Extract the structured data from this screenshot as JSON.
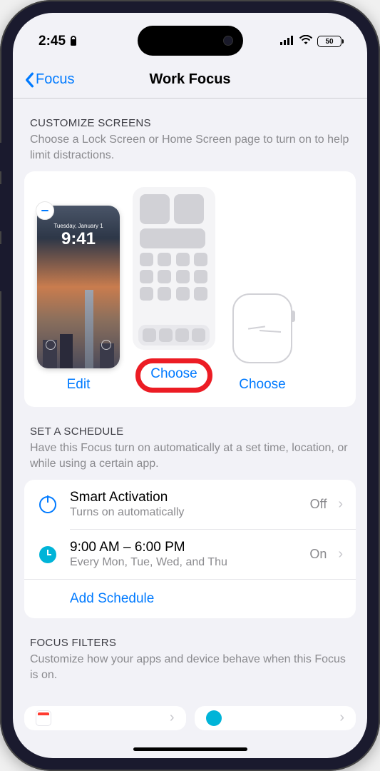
{
  "status_bar": {
    "time": "2:45",
    "battery": "50"
  },
  "nav": {
    "back_label": "Focus",
    "title": "Work Focus"
  },
  "customize": {
    "title": "CUSTOMIZE SCREENS",
    "subtitle": "Choose a Lock Screen or Home Screen page to turn on to help limit distractions.",
    "lock_preview": {
      "day": "Tuesday, January 1",
      "time": "9:41"
    },
    "lock_label": "Edit",
    "home_label": "Choose",
    "watch_label": "Choose"
  },
  "schedule": {
    "title": "SET A SCHEDULE",
    "subtitle": "Have this Focus turn on automatically at a set time, location, or while using a certain app.",
    "items": [
      {
        "title": "Smart Activation",
        "subtitle": "Turns on automatically",
        "status": "Off"
      },
      {
        "title": "9:00 AM – 6:00 PM",
        "subtitle": "Every Mon, Tue, Wed, and Thu",
        "status": "On"
      }
    ],
    "add_label": "Add Schedule"
  },
  "filters": {
    "title": "FOCUS FILTERS",
    "subtitle": "Customize how your apps and device behave when this Focus is on."
  }
}
